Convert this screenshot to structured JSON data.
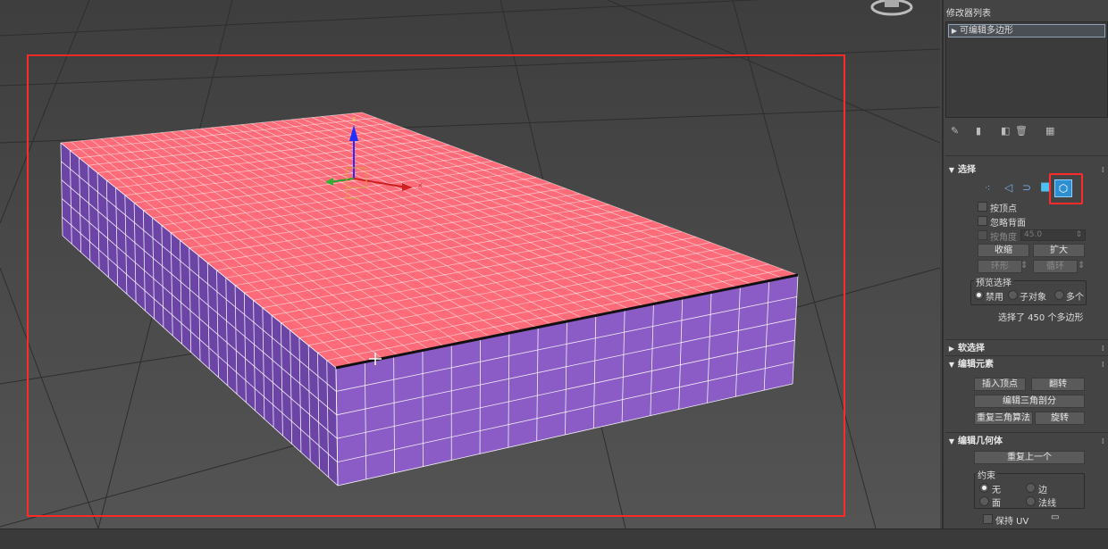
{
  "panel": {
    "modifier_list_label": "修改器列表",
    "stack_item_label": "可编辑多边形",
    "selection": {
      "title": "选择",
      "by_vertex": "按顶点",
      "ignore_backfacing": "忽略背面",
      "by_angle": "按角度",
      "angle_value": "45.0",
      "shrink": "收缩",
      "grow": "扩大",
      "ring": "环形",
      "loop": "循环",
      "preview_title": "预览选择",
      "preview_off": "禁用",
      "preview_subobj": "子对象",
      "preview_multi": "多个",
      "status": "选择了 450 个多边形"
    },
    "soft_selection": {
      "title": "软选择"
    },
    "edit_elements": {
      "title": "编辑元素",
      "insert_vertex": "插入顶点",
      "flip": "翻转",
      "edit_triangulation": "编辑三角剖分",
      "retriangulate": "重复三角算法",
      "turn": "旋转"
    },
    "edit_geometry": {
      "title": "编辑几何体",
      "repeat_last": "重复上一个",
      "constraints_title": "约束",
      "none": "无",
      "edge": "边",
      "face": "面",
      "normal": "法线",
      "preserve_uv": "保持 UV"
    }
  },
  "viewport": {
    "gizmo_z_label": "z",
    "gizmo_x_label": "x",
    "top_color": "#ff6b78",
    "side_color": "#8c5cc6",
    "highlight_color": "#ff2a2a"
  }
}
